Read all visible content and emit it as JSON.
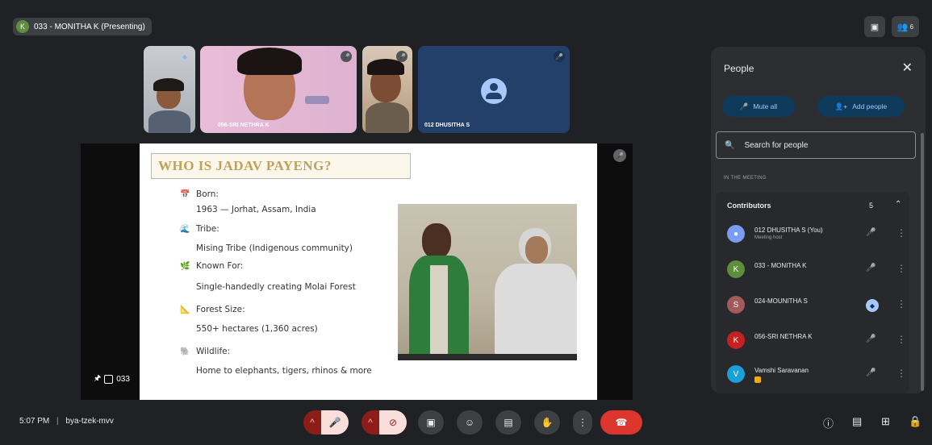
{
  "topbar": {
    "presenter_initial": "K",
    "presenter_label": "033 - MONITHA K (Presenting)",
    "icons": [
      "present-screen-icon",
      "people-count-icon"
    ],
    "people_count": "6"
  },
  "tiles": [
    {
      "name": ""
    },
    {
      "name": "056-SRI NETHRA K"
    },
    {
      "name": ""
    },
    {
      "name": "012 DHUSITHA S"
    }
  ],
  "slide": {
    "title": "WHO IS JADAV PAYENG?",
    "items": [
      {
        "label": "Born:",
        "value": "1963 — Jorhat, Assam, India",
        "icon": "📅"
      },
      {
        "label": "Tribe:",
        "value": "Mising Tribe (Indigenous community)",
        "icon": "🌊"
      },
      {
        "label": "Known For:",
        "value": "Single-handedly creating Molai Forest",
        "icon": "🌿"
      },
      {
        "label": "Forest Size:",
        "value": "550+ hectares (1,360 acres)",
        "icon": "📐"
      },
      {
        "label": "Wildlife:",
        "value": "Home to elephants, tigers, rhinos & more",
        "icon": "🐘"
      }
    ]
  },
  "main_tile_label": "033",
  "people_panel": {
    "title": "People",
    "mute_all": "Mute all",
    "add_people": "Add people",
    "search_placeholder": "Search for people",
    "section_label": "IN THE MEETING",
    "contributors_label": "Contributors",
    "contributors_count": "5",
    "participants": [
      {
        "name": "012 DHUSITHA S (You)",
        "sub": "Meeting host",
        "initial": "",
        "color": "#7b9cf0"
      },
      {
        "name": "033 - MONITHA K",
        "sub": "",
        "initial": "K",
        "color": "#5f8d3e"
      },
      {
        "name": "024-MOUNITHA S",
        "sub": "",
        "initial": "S",
        "color": "#a35a5a"
      },
      {
        "name": "056-SRI NETHRA K",
        "sub": "",
        "initial": "K",
        "color": "#c5221f"
      },
      {
        "name": "Vamshi Saravanan",
        "sub": "",
        "initial": "V",
        "color": "#1a9fd6"
      }
    ]
  },
  "bottombar": {
    "time": "5:07 PM",
    "separator": "|",
    "meeting_code": "bya-tzek-mvv"
  }
}
